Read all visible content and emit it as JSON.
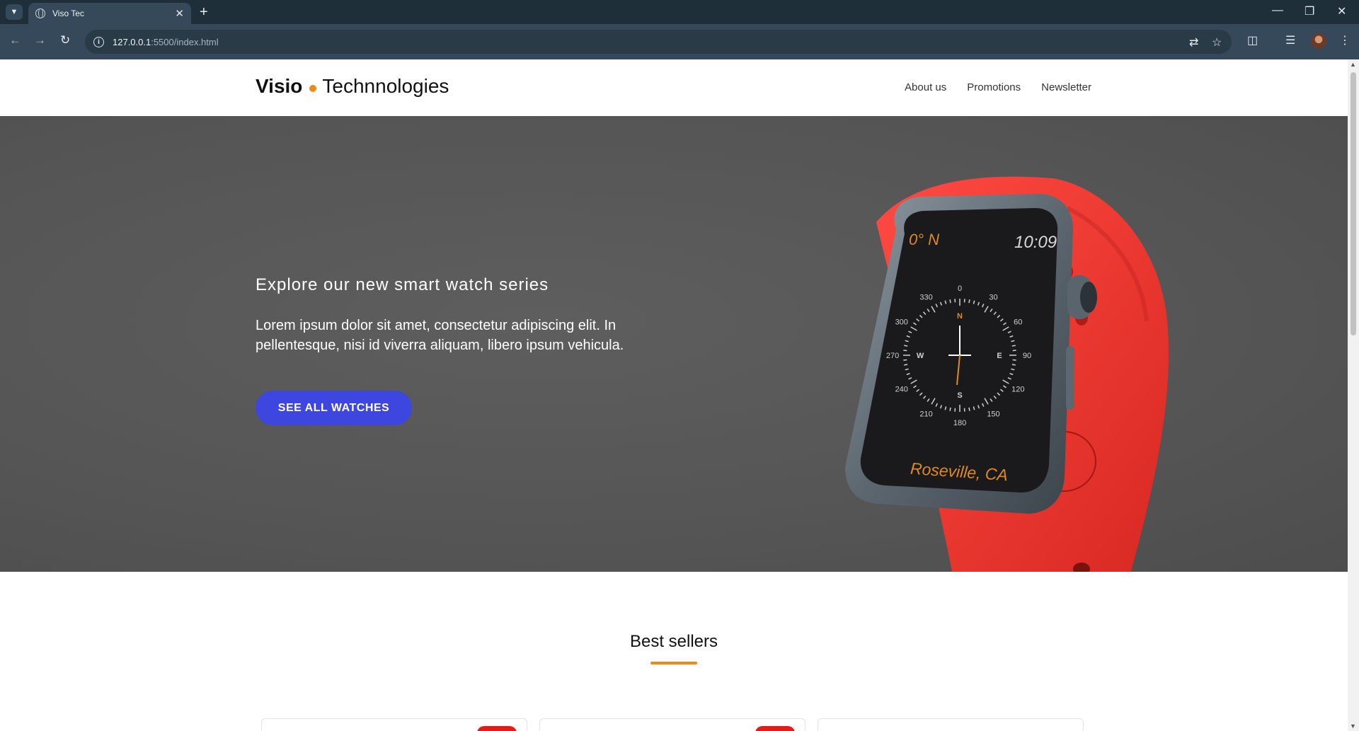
{
  "browser": {
    "tab_title": "Viso Tec",
    "url_host": "127.0.0.1",
    "url_path": ":5500/index.html"
  },
  "site": {
    "logo_bold": "Visio",
    "logo_rest": "Technnologies",
    "nav": [
      "About us",
      "Promotions",
      "Newsletter"
    ]
  },
  "hero": {
    "eyebrow": "Explore our new smart watch series",
    "body": "Lorem ipsum dolor sit amet, consectetur adipiscing elit. In pellentesque, nisi id viverra aliquam, libero ipsum vehicula.",
    "cta": "SEE ALL WATCHES",
    "watch": {
      "latitude": "0° N",
      "time": "10:09",
      "location": "Roseville, CA",
      "compass_degrees": [
        "0",
        "30",
        "60",
        "90",
        "120",
        "150",
        "180",
        "210",
        "240",
        "270",
        "300",
        "330"
      ],
      "compass_letters": [
        "N",
        "E",
        "S",
        "W"
      ]
    }
  },
  "best_sellers": {
    "title": "Best sellers"
  },
  "colors": {
    "accent_orange": "#ef8a12",
    "cta_blue": "#3d47e0",
    "band_red": "#e83a36",
    "badge_red": "#e31b1b"
  }
}
